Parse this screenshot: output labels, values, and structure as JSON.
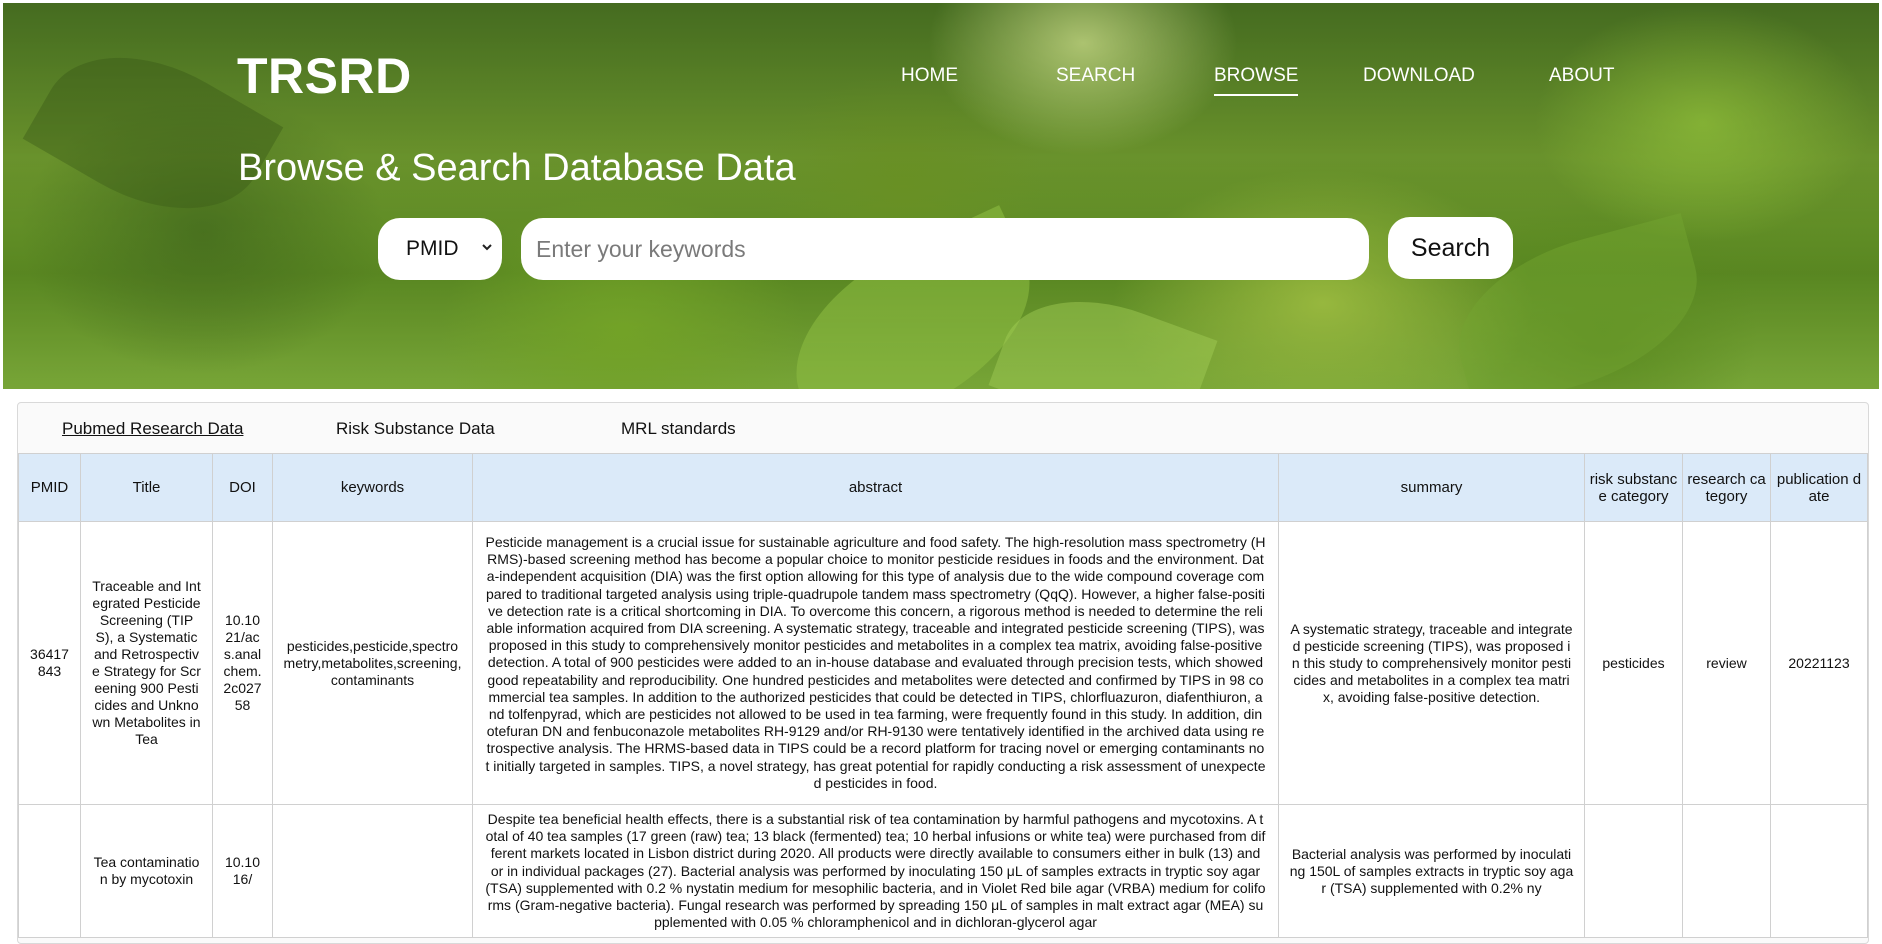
{
  "app": {
    "brand": "TRSRD"
  },
  "nav": {
    "items": [
      {
        "label": "HOME"
      },
      {
        "label": "SEARCH"
      },
      {
        "label": "BROWSE",
        "active": true
      },
      {
        "label": "DOWNLOAD"
      },
      {
        "label": "ABOUT"
      }
    ]
  },
  "hero": {
    "title": "Browse & Search Database Data",
    "search": {
      "field_selected": "PMID",
      "placeholder": "Enter your keywords",
      "button_label": "Search"
    }
  },
  "tabs": [
    {
      "label": "Pubmed Research Data",
      "active": true
    },
    {
      "label": "Risk Substance Data"
    },
    {
      "label": "MRL standards"
    }
  ],
  "table": {
    "columns": [
      "PMID",
      "Title",
      "DOI",
      "keywords",
      "abstract",
      "summary",
      "risk substance category",
      "research category",
      "publication date"
    ],
    "rows": [
      {
        "pmid": "36417843",
        "title": "Traceable and Integrated Pesticide Screening (TIPS), a Systematic and Retrospective Strategy for Screening 900 Pesticides and Unknown Metabolites in Tea",
        "doi": "10.1021/acs.analchem.2c02758",
        "keywords": "pesticides,pesticide,spectrometry,metabolites,screening,contaminants",
        "abstract": "Pesticide management is a crucial issue for sustainable agriculture and food safety. The high-resolution mass spectrometry (HRMS)-based screening method has become a popular choice to monitor pesticide residues in foods and the environment. Data-independent acquisition (DIA) was the first option allowing for this type of analysis due to the wide compound coverage compared to traditional targeted analysis using triple-quadrupole tandem mass spectrometry (QqQ). However, a higher false-positive detection rate is a critical shortcoming in DIA. To overcome this concern, a rigorous method is needed to determine the reliable information acquired from DIA screening. A systematic strategy, traceable and integrated pesticide screening (TIPS), was proposed in this study to comprehensively monitor pesticides and metabolites in a complex tea matrix, avoiding false-positive detection. A total of 900 pesticides were added to an in-house database and evaluated through precision tests, which showed good repeatability and reproducibility. One hundred pesticides and metabolites were detected and confirmed by TIPS in 98 commercial tea samples. In addition to the authorized pesticides that could be detected in TIPS, chlorfluazuron, diafenthiuron, and tolfenpyrad, which are pesticides not allowed to be used in tea farming, were frequently found in this study. In addition, dinotefuran DN and fenbuconazole metabolites RH-9129 and/or RH-9130 were tentatively identified in the archived data using retrospective analysis. The HRMS-based data in TIPS could be a record platform for tracing novel or emerging contaminants not initially targeted in samples. TIPS, a novel strategy, has great potential for rapidly conducting a risk assessment of unexpected pesticides in food.",
        "summary": "A systematic strategy, traceable and integrated pesticide screening (TIPS), was proposed in this study to comprehensively monitor pesticides and metabolites in a complex tea matrix, avoiding false-positive detection.",
        "risk_category": "pesticides",
        "research_category": "review",
        "publication_date": "20221123"
      },
      {
        "pmid": "",
        "title": "Tea contamination by mycotoxin",
        "doi": "10.1016/",
        "keywords": "",
        "abstract": "Despite tea beneficial health effects, there is a substantial risk of tea contamination by harmful pathogens and mycotoxins. A total of 40 tea samples (17 green (raw) tea; 13 black (fermented) tea; 10 herbal infusions or white tea) were purchased from different markets located in Lisbon district during 2020. All products were directly available to consumers either in bulk (13) and or in individual packages (27). Bacterial analysis was performed by inoculating 150 μL of samples extracts in tryptic soy agar (TSA) supplemented with 0.2 % nystatin medium for mesophilic bacteria, and in Violet Red bile agar (VRBA) medium for coliforms (Gram-negative bacteria). Fungal research was performed by spreading 150 μL of samples in malt extract agar (MEA) supplemented with 0.05 % chloramphenicol and in dichloran-glycerol agar",
        "summary": "Bacterial analysis was performed by inoculating 150L of samples extracts in tryptic soy agar (TSA) supplemented with 0.2% ny",
        "risk_category": "",
        "research_category": "",
        "publication_date": ""
      }
    ]
  }
}
